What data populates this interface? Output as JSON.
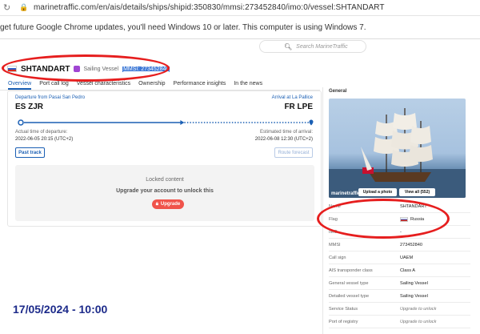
{
  "browser": {
    "url": "marinetraffic.com/en/ais/details/ships/shipid:350830/mmsi:273452840/imo:0/vessel:SHTANDART"
  },
  "notice": "get future Google Chrome updates, you'll need Windows 10 or later. This computer is using Windows 7.",
  "search": {
    "placeholder": "Search MarineTraffic"
  },
  "vessel": {
    "name": "SHTANDART",
    "type": "Sailing Vessel",
    "mmsi_badge": "MMSI: 273452840"
  },
  "tabs": [
    "Overview",
    "Port call log",
    "Vessel characteristics",
    "Ownership",
    "Performance insights",
    "In the news"
  ],
  "voyage": {
    "departure_label": "Departure from Pasai San Pedro",
    "departure_code": "ES ZJR",
    "arrival_label": "Arrival at La Pallice",
    "arrival_code": "FR LPE",
    "actual_departure_label": "Actual time of departure:",
    "actual_departure_value": "2022-06-05 20:15 (UTC+2)",
    "estimated_arrival_label": "Estimated time of arrival:",
    "estimated_arrival_value": "2022-06-08 12:30 (UTC+2)",
    "progress": 0.56,
    "past_track_label": "Past track",
    "route_forecast_label": "Route forecast"
  },
  "locked": {
    "title": "Locked content",
    "message": "Upgrade your account to unlock this",
    "upgrade_label": "Upgrade"
  },
  "general": {
    "title": "General",
    "photo_watermark": "marinetraffic",
    "upload_label": "Upload a photo",
    "view_all_label": "View all (552)",
    "rows": [
      {
        "k": "Name",
        "v": "SHTANDART"
      },
      {
        "k": "Flag",
        "v": "Russia"
      },
      {
        "k": "IMO",
        "v": "-"
      },
      {
        "k": "MMSI",
        "v": "273452840"
      },
      {
        "k": "Call sign",
        "v": "UAEM"
      },
      {
        "k": "AIS transponder class",
        "v": "Class A"
      },
      {
        "k": "General vessel type",
        "v": "Sailing Vessel"
      },
      {
        "k": "Detailed vessel type",
        "v": "Sailing Vessel"
      },
      {
        "k": "Service Status",
        "v": "Upgrade to unlock"
      },
      {
        "k": "Port of registry",
        "v": "Upgrade to unlock"
      }
    ]
  },
  "timestamp": "17/05/2024 - 10:00",
  "colors": {
    "accent": "#1a5fb4",
    "annotation": "#e61e1e",
    "upgrade": "#f0534b",
    "stamp": "#1c2a8a"
  }
}
